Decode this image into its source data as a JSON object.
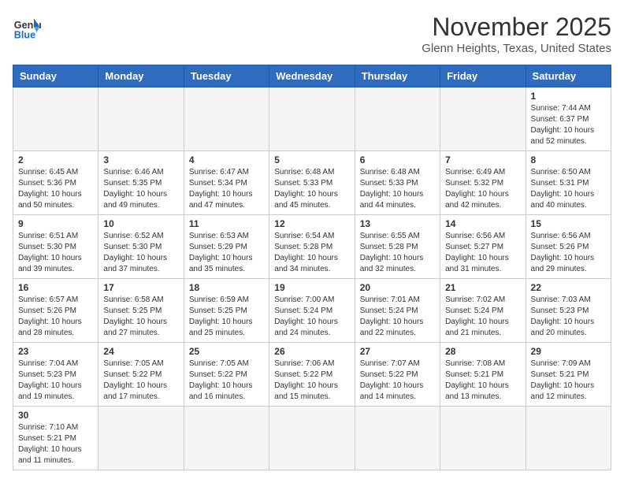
{
  "logo": {
    "general": "General",
    "blue": "Blue"
  },
  "header": {
    "month": "November 2025",
    "location": "Glenn Heights, Texas, United States"
  },
  "days_of_week": [
    "Sunday",
    "Monday",
    "Tuesday",
    "Wednesday",
    "Thursday",
    "Friday",
    "Saturday"
  ],
  "weeks": [
    [
      {
        "day": "",
        "empty": true
      },
      {
        "day": "",
        "empty": true
      },
      {
        "day": "",
        "empty": true
      },
      {
        "day": "",
        "empty": true
      },
      {
        "day": "",
        "empty": true
      },
      {
        "day": "",
        "empty": true
      },
      {
        "day": "1",
        "sunrise": "Sunrise: 7:44 AM",
        "sunset": "Sunset: 6:37 PM",
        "daylight": "Daylight: 10 hours and 52 minutes."
      }
    ],
    [
      {
        "day": "2",
        "sunrise": "Sunrise: 6:45 AM",
        "sunset": "Sunset: 5:36 PM",
        "daylight": "Daylight: 10 hours and 50 minutes."
      },
      {
        "day": "3",
        "sunrise": "Sunrise: 6:46 AM",
        "sunset": "Sunset: 5:35 PM",
        "daylight": "Daylight: 10 hours and 49 minutes."
      },
      {
        "day": "4",
        "sunrise": "Sunrise: 6:47 AM",
        "sunset": "Sunset: 5:34 PM",
        "daylight": "Daylight: 10 hours and 47 minutes."
      },
      {
        "day": "5",
        "sunrise": "Sunrise: 6:48 AM",
        "sunset": "Sunset: 5:33 PM",
        "daylight": "Daylight: 10 hours and 45 minutes."
      },
      {
        "day": "6",
        "sunrise": "Sunrise: 6:48 AM",
        "sunset": "Sunset: 5:33 PM",
        "daylight": "Daylight: 10 hours and 44 minutes."
      },
      {
        "day": "7",
        "sunrise": "Sunrise: 6:49 AM",
        "sunset": "Sunset: 5:32 PM",
        "daylight": "Daylight: 10 hours and 42 minutes."
      },
      {
        "day": "8",
        "sunrise": "Sunrise: 6:50 AM",
        "sunset": "Sunset: 5:31 PM",
        "daylight": "Daylight: 10 hours and 40 minutes."
      }
    ],
    [
      {
        "day": "9",
        "sunrise": "Sunrise: 6:51 AM",
        "sunset": "Sunset: 5:30 PM",
        "daylight": "Daylight: 10 hours and 39 minutes."
      },
      {
        "day": "10",
        "sunrise": "Sunrise: 6:52 AM",
        "sunset": "Sunset: 5:30 PM",
        "daylight": "Daylight: 10 hours and 37 minutes."
      },
      {
        "day": "11",
        "sunrise": "Sunrise: 6:53 AM",
        "sunset": "Sunset: 5:29 PM",
        "daylight": "Daylight: 10 hours and 35 minutes."
      },
      {
        "day": "12",
        "sunrise": "Sunrise: 6:54 AM",
        "sunset": "Sunset: 5:28 PM",
        "daylight": "Daylight: 10 hours and 34 minutes."
      },
      {
        "day": "13",
        "sunrise": "Sunrise: 6:55 AM",
        "sunset": "Sunset: 5:28 PM",
        "daylight": "Daylight: 10 hours and 32 minutes."
      },
      {
        "day": "14",
        "sunrise": "Sunrise: 6:56 AM",
        "sunset": "Sunset: 5:27 PM",
        "daylight": "Daylight: 10 hours and 31 minutes."
      },
      {
        "day": "15",
        "sunrise": "Sunrise: 6:56 AM",
        "sunset": "Sunset: 5:26 PM",
        "daylight": "Daylight: 10 hours and 29 minutes."
      }
    ],
    [
      {
        "day": "16",
        "sunrise": "Sunrise: 6:57 AM",
        "sunset": "Sunset: 5:26 PM",
        "daylight": "Daylight: 10 hours and 28 minutes."
      },
      {
        "day": "17",
        "sunrise": "Sunrise: 6:58 AM",
        "sunset": "Sunset: 5:25 PM",
        "daylight": "Daylight: 10 hours and 27 minutes."
      },
      {
        "day": "18",
        "sunrise": "Sunrise: 6:59 AM",
        "sunset": "Sunset: 5:25 PM",
        "daylight": "Daylight: 10 hours and 25 minutes."
      },
      {
        "day": "19",
        "sunrise": "Sunrise: 7:00 AM",
        "sunset": "Sunset: 5:24 PM",
        "daylight": "Daylight: 10 hours and 24 minutes."
      },
      {
        "day": "20",
        "sunrise": "Sunrise: 7:01 AM",
        "sunset": "Sunset: 5:24 PM",
        "daylight": "Daylight: 10 hours and 22 minutes."
      },
      {
        "day": "21",
        "sunrise": "Sunrise: 7:02 AM",
        "sunset": "Sunset: 5:24 PM",
        "daylight": "Daylight: 10 hours and 21 minutes."
      },
      {
        "day": "22",
        "sunrise": "Sunrise: 7:03 AM",
        "sunset": "Sunset: 5:23 PM",
        "daylight": "Daylight: 10 hours and 20 minutes."
      }
    ],
    [
      {
        "day": "23",
        "sunrise": "Sunrise: 7:04 AM",
        "sunset": "Sunset: 5:23 PM",
        "daylight": "Daylight: 10 hours and 19 minutes."
      },
      {
        "day": "24",
        "sunrise": "Sunrise: 7:05 AM",
        "sunset": "Sunset: 5:22 PM",
        "daylight": "Daylight: 10 hours and 17 minutes."
      },
      {
        "day": "25",
        "sunrise": "Sunrise: 7:05 AM",
        "sunset": "Sunset: 5:22 PM",
        "daylight": "Daylight: 10 hours and 16 minutes."
      },
      {
        "day": "26",
        "sunrise": "Sunrise: 7:06 AM",
        "sunset": "Sunset: 5:22 PM",
        "daylight": "Daylight: 10 hours and 15 minutes."
      },
      {
        "day": "27",
        "sunrise": "Sunrise: 7:07 AM",
        "sunset": "Sunset: 5:22 PM",
        "daylight": "Daylight: 10 hours and 14 minutes."
      },
      {
        "day": "28",
        "sunrise": "Sunrise: 7:08 AM",
        "sunset": "Sunset: 5:21 PM",
        "daylight": "Daylight: 10 hours and 13 minutes."
      },
      {
        "day": "29",
        "sunrise": "Sunrise: 7:09 AM",
        "sunset": "Sunset: 5:21 PM",
        "daylight": "Daylight: 10 hours and 12 minutes."
      }
    ],
    [
      {
        "day": "30",
        "sunrise": "Sunrise: 7:10 AM",
        "sunset": "Sunset: 5:21 PM",
        "daylight": "Daylight: 10 hours and 11 minutes."
      },
      {
        "day": "",
        "empty": true
      },
      {
        "day": "",
        "empty": true
      },
      {
        "day": "",
        "empty": true
      },
      {
        "day": "",
        "empty": true
      },
      {
        "day": "",
        "empty": true
      },
      {
        "day": "",
        "empty": true
      }
    ]
  ]
}
